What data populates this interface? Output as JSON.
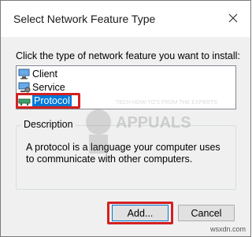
{
  "window": {
    "title": "Select Network Feature Type"
  },
  "instruction": "Click the type of network feature you want to install:",
  "features": [
    {
      "label": "Client",
      "icon": "client-icon"
    },
    {
      "label": "Service",
      "icon": "service-icon"
    },
    {
      "label": "Protocol",
      "icon": "protocol-icon",
      "selected": true
    }
  ],
  "description": {
    "legend": "Description",
    "text": "A protocol is a language your computer uses to communicate with other computers."
  },
  "buttons": {
    "add": "Add...",
    "cancel": "Cancel"
  },
  "watermark": {
    "brand": "APPUALS",
    "tagline": "TECH HOW-TO'S FROM THE EXPERTS"
  },
  "site": "wsxdn.com",
  "colors": {
    "selection": "#0078d7",
    "highlight": "#d42020",
    "dialog_bg": "#f0f0f0"
  }
}
